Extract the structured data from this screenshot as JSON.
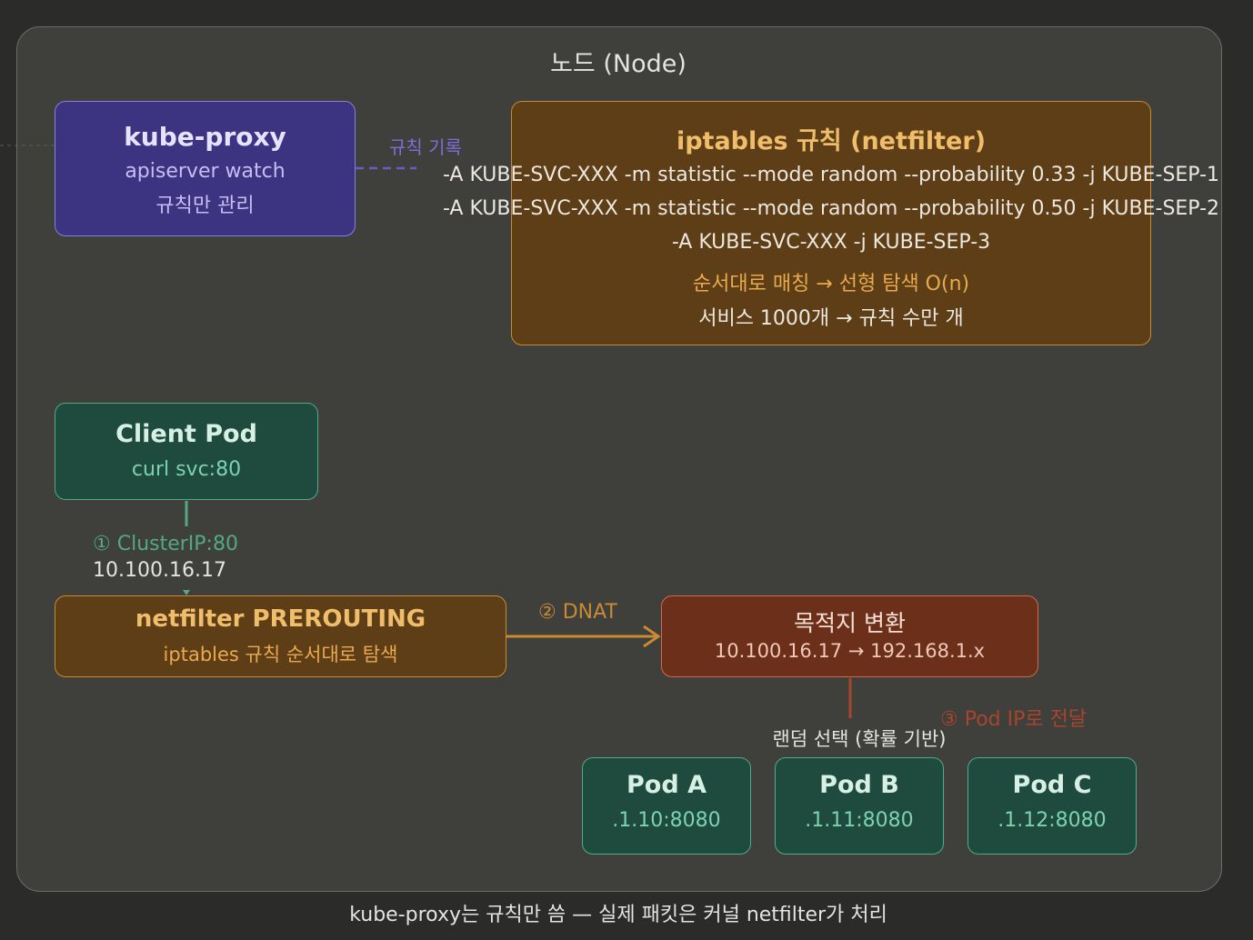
{
  "node": {
    "title": "노드 (Node)"
  },
  "kube_proxy": {
    "title": "kube-proxy",
    "sub1": "apiserver watch",
    "sub2": "규칙만 관리"
  },
  "rule_write_label": "규칙 기록",
  "iptables": {
    "title": "iptables 규칙 (netfilter)",
    "rules": [
      "-A KUBE-SVC-XXX -m statistic --mode random --probability 0.33 -j KUBE-SEP-1",
      "-A KUBE-SVC-XXX -m statistic --mode random --probability 0.50 -j KUBE-SEP-2",
      "-A KUBE-SVC-XXX -j KUBE-SEP-3"
    ],
    "note1": "순서대로 매칭 → 선형 탐색 O(n)",
    "note2": "서비스 1000개 → 규칙 수만 개"
  },
  "client_pod": {
    "title": "Client Pod",
    "sub": "curl svc:80"
  },
  "step1": {
    "label": "① ClusterIP:80",
    "address": "10.100.16.17"
  },
  "prerouting": {
    "title": "netfilter PREROUTING",
    "sub": "iptables 규칙 순서대로 탐색"
  },
  "step2": {
    "label": "② DNAT"
  },
  "dest_translation": {
    "title": "목적지 변환",
    "sub": "10.100.16.17 → 192.168.1.x"
  },
  "step3": {
    "label": "③ Pod IP로 전달"
  },
  "random_select": "랜덤 선택 (확률 기반)",
  "pods": [
    {
      "title": "Pod A",
      "sub": ".1.10:8080"
    },
    {
      "title": "Pod B",
      "sub": ".1.11:8080"
    },
    {
      "title": "Pod C",
      "sub": ".1.12:8080"
    }
  ],
  "footer": "kube-proxy는 규칙만 씀 — 실제 패킷은 커널 netfilter가 처리",
  "colors": {
    "kube_proxy": "#3c3480",
    "iptables": "#5e3e16",
    "client": "#1f4a3e",
    "dest": "#6b2f1a",
    "step1": "#52a982",
    "step2": "#c88a33",
    "step3": "#a8452c"
  }
}
